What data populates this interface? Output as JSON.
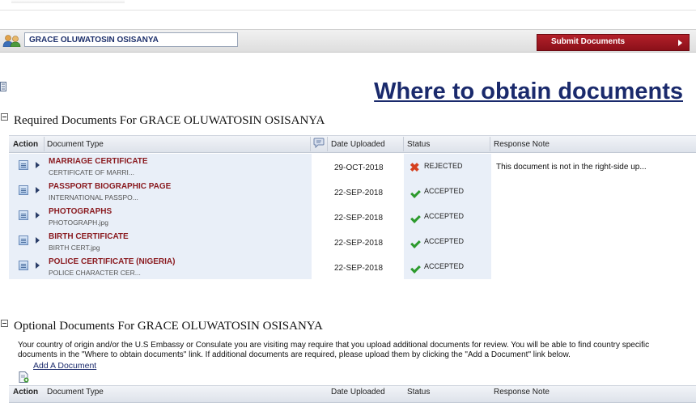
{
  "header": {
    "applicant_name": "GRACE OLUWATOSIN OSISANYA",
    "submit_label": "Submit Documents"
  },
  "where_link": "Where to obtain documents",
  "required": {
    "title": "Required Documents For GRACE OLUWATOSIN OSISANYA",
    "columns": {
      "action": "Action",
      "document_type": "Document Type",
      "date_uploaded": "Date Uploaded",
      "status": "Status",
      "response_note": "Response Note"
    },
    "rows": [
      {
        "title": "MARRIAGE CERTIFICATE",
        "file": "CERTIFICATE OF MARRI...",
        "date": "29-OCT-2018",
        "status": "REJECTED",
        "note": "This document is not in the right-side up..."
      },
      {
        "title": "PASSPORT BIOGRAPHIC PAGE",
        "file": "INTERNATIONAL PASSPO...",
        "date": "22-SEP-2018",
        "status": "ACCEPTED",
        "note": ""
      },
      {
        "title": "PHOTOGRAPHS",
        "file": "PHOTOGRAPH.jpg",
        "date": "22-SEP-2018",
        "status": "ACCEPTED",
        "note": ""
      },
      {
        "title": "BIRTH CERTIFICATE",
        "file": "BIRTH CERT.jpg",
        "date": "22-SEP-2018",
        "status": "ACCEPTED",
        "note": ""
      },
      {
        "title": "POLICE CERTIFICATE (NIGERIA)",
        "file": "POLICE CHARACTER CER...",
        "date": "22-SEP-2018",
        "status": "ACCEPTED",
        "note": ""
      }
    ]
  },
  "optional": {
    "title": "Optional Documents For GRACE OLUWATOSIN OSISANYA",
    "description": "Your country of origin and/or the U.S Embassy or Consulate you are visiting may require that you upload additional documents for review. You will be able to find country specific documents in the \"Where to obtain documents\" link. If additional documents are required, please upload them by clicking the \"Add a Document\" link below.",
    "add_label": "Add A Document",
    "columns": {
      "action": "Action",
      "document_type": "Document Type",
      "date_uploaded": "Date Uploaded",
      "status": "Status",
      "response_note": "Response Note"
    }
  },
  "icons": {
    "users": "users-icon",
    "print": "print-icon",
    "collapse": "collapse-icon",
    "comment": "comment-icon",
    "view": "document-view-icon",
    "expand": "expand-arrow-icon",
    "accepted": "check-icon",
    "rejected": "x-icon",
    "add": "add-document-icon"
  },
  "colors": {
    "submit_button": "#9b1620",
    "doc_title": "#8a1a1f",
    "link": "#1a2a6c",
    "accepted": "#2c9a2c",
    "rejected": "#d5401f"
  }
}
